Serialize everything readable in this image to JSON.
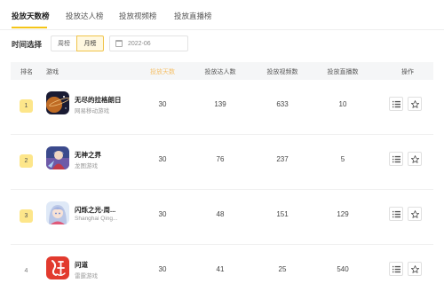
{
  "tabs": [
    "投放天数榜",
    "投放达人榜",
    "投放视频榜",
    "投放直播榜"
  ],
  "filter": {
    "label": "时间选择",
    "week_label": "周榜",
    "month_label": "月榜",
    "date_value": "2022-06"
  },
  "table": {
    "headers": {
      "rank": "排名",
      "game": "游戏",
      "days": "投放天数",
      "creators": "投放达人数",
      "videos": "投放视频数",
      "live": "投放直播数",
      "actions": "操作"
    },
    "rows": [
      {
        "rank": "1",
        "name": "无尽的拉格朗日",
        "publisher": "网易移动游戏",
        "days": "30",
        "creators": "139",
        "videos": "633",
        "live": "10",
        "icon": "space-game-icon"
      },
      {
        "rank": "2",
        "name": "无神之界",
        "publisher": "龙图游戏",
        "days": "30",
        "creators": "76",
        "videos": "237",
        "live": "5",
        "icon": "character-game-icon"
      },
      {
        "rank": "3",
        "name": "闪烁之光-周...",
        "publisher": "Shanghai Qing...",
        "days": "30",
        "creators": "48",
        "videos": "151",
        "live": "129",
        "icon": "anime-girl-game-icon"
      },
      {
        "rank": "4",
        "name": "问道",
        "publisher": "雷霆游戏",
        "days": "30",
        "creators": "41",
        "videos": "25",
        "live": "540",
        "icon": "calligraphy-game-icon"
      }
    ]
  }
}
